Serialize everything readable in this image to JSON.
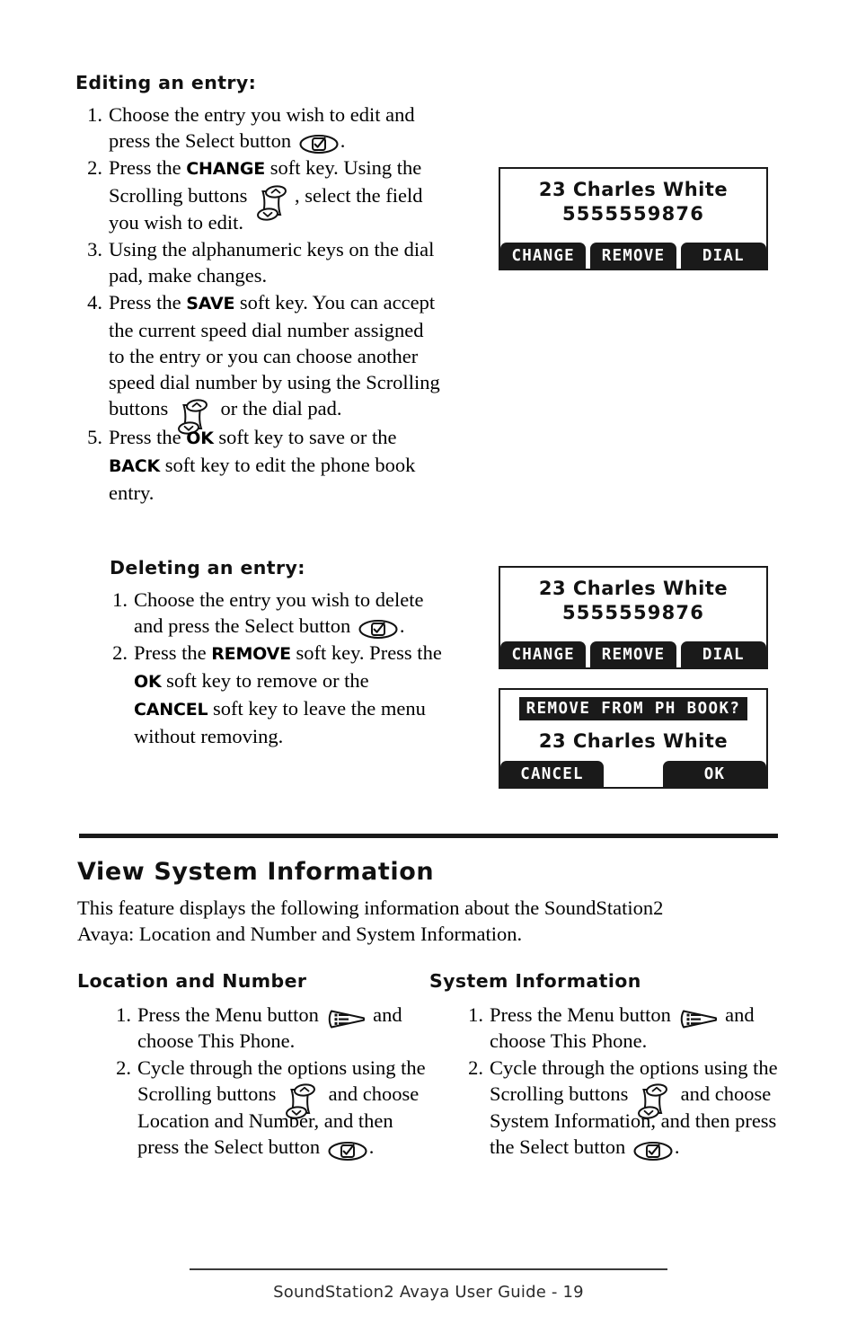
{
  "page": {
    "footer": "SoundStation2 Avaya User Guide - 19",
    "page_number": "19"
  },
  "sections": {
    "editing": {
      "heading": "Editing an entry:",
      "steps": [
        {
          "num": "1.",
          "parts": [
            {
              "t": "text",
              "v": "Choose the entry you wish to edit and press the Select button "
            },
            {
              "t": "icon",
              "v": "select-button-icon"
            },
            {
              "t": "text",
              "v": "."
            }
          ]
        },
        {
          "num": "2.",
          "parts": [
            {
              "t": "text",
              "v": "Press the "
            },
            {
              "t": "kw",
              "v": "CHANGE"
            },
            {
              "t": "text",
              "v": " soft key.  Using the Scrolling buttons "
            },
            {
              "t": "icon",
              "v": "scrolling-buttons-icon"
            },
            {
              "t": "text",
              "v": ", select the field you wish to edit."
            }
          ]
        },
        {
          "num": "3.",
          "parts": [
            {
              "t": "text",
              "v": "Using the alphanumeric keys on the dial pad, make changes."
            }
          ]
        },
        {
          "num": "4.",
          "parts": [
            {
              "t": "text",
              "v": "Press the "
            },
            {
              "t": "kw",
              "v": "SAVE"
            },
            {
              "t": "text",
              "v": " soft key.  You can accept the current speed dial number assigned to the entry or you can choose another speed dial number by using the Scrolling buttons "
            },
            {
              "t": "icon",
              "v": "scrolling-buttons-icon"
            },
            {
              "t": "text",
              "v": " or the dial pad."
            }
          ]
        },
        {
          "num": "5.",
          "parts": [
            {
              "t": "text",
              "v": "Press the "
            },
            {
              "t": "kw",
              "v": "OK"
            },
            {
              "t": "text",
              "v": " soft key to save or the "
            },
            {
              "t": "kw",
              "v": "BACK"
            },
            {
              "t": "text",
              "v": " soft key to edit the phone book entry."
            }
          ]
        }
      ]
    },
    "deleting": {
      "heading": "Deleting an entry:",
      "steps": [
        {
          "num": "1.",
          "parts": [
            {
              "t": "text",
              "v": "Choose the entry you wish to delete and press the Select button "
            },
            {
              "t": "icon",
              "v": "select-button-icon"
            },
            {
              "t": "text",
              "v": "."
            }
          ]
        },
        {
          "num": "2.",
          "parts": [
            {
              "t": "text",
              "v": "Press the "
            },
            {
              "t": "kw",
              "v": "REMOVE"
            },
            {
              "t": "text",
              "v": " soft key.  Press the "
            },
            {
              "t": "kw",
              "v": "OK"
            },
            {
              "t": "text",
              "v": " soft key to remove or the "
            },
            {
              "t": "kw",
              "v": "CANCEL"
            },
            {
              "t": "text",
              "v": " soft key to leave the menu without removing."
            }
          ]
        }
      ]
    },
    "view_system_information": {
      "heading": "View System Information",
      "intro": "This feature displays the following information about the SoundStation2 Avaya: Location and Number and System Information.",
      "left_column": {
        "heading": "Location and Number",
        "steps": [
          {
            "num": "1.",
            "parts": [
              {
                "t": "text",
                "v": "Press the Menu button "
              },
              {
                "t": "icon",
                "v": "menu-button-icon"
              },
              {
                "t": "text",
                "v": " and choose This Phone."
              }
            ]
          },
          {
            "num": "2.",
            "parts": [
              {
                "t": "text",
                "v": "Cycle through the options using the Scrolling buttons "
              },
              {
                "t": "icon",
                "v": "scrolling-buttons-icon"
              },
              {
                "t": "text",
                "v": " and choose Location and Number, and then press the Select button "
              },
              {
                "t": "icon",
                "v": "select-button-icon"
              },
              {
                "t": "text",
                "v": "."
              }
            ]
          }
        ]
      },
      "right_column": {
        "heading": "System Information",
        "steps": [
          {
            "num": "1.",
            "parts": [
              {
                "t": "text",
                "v": "Press the Menu button "
              },
              {
                "t": "icon",
                "v": "menu-button-icon"
              },
              {
                "t": "text",
                "v": " and choose This Phone."
              }
            ]
          },
          {
            "num": "2.",
            "parts": [
              {
                "t": "text",
                "v": "Cycle through the options using the Scrolling buttons "
              },
              {
                "t": "icon",
                "v": "scrolling-buttons-icon"
              },
              {
                "t": "text",
                "v": " and choose System Information, and then press the Select button "
              },
              {
                "t": "icon",
                "v": "select-button-icon"
              },
              {
                "t": "text",
                "v": "."
              }
            ]
          }
        ]
      }
    }
  },
  "lcd_screens": [
    {
      "id": "phonebook-entry-screen-1",
      "line1": "23 Charles White",
      "line2": "5555559876",
      "softkeys": [
        "CHANGE",
        "REMOVE",
        "DIAL"
      ]
    },
    {
      "id": "phonebook-entry-screen-2",
      "line1": "23 Charles White",
      "line2": "5555559876",
      "softkeys": [
        "CHANGE",
        "REMOVE",
        "DIAL"
      ]
    },
    {
      "id": "remove-confirm-screen",
      "title": "REMOVE FROM PH BOOK?",
      "line1": "23 Charles White",
      "softkeys": [
        "CANCEL",
        "OK"
      ]
    }
  ],
  "colors": {
    "ink": "#1a1a1a",
    "paper": "#ffffff"
  }
}
